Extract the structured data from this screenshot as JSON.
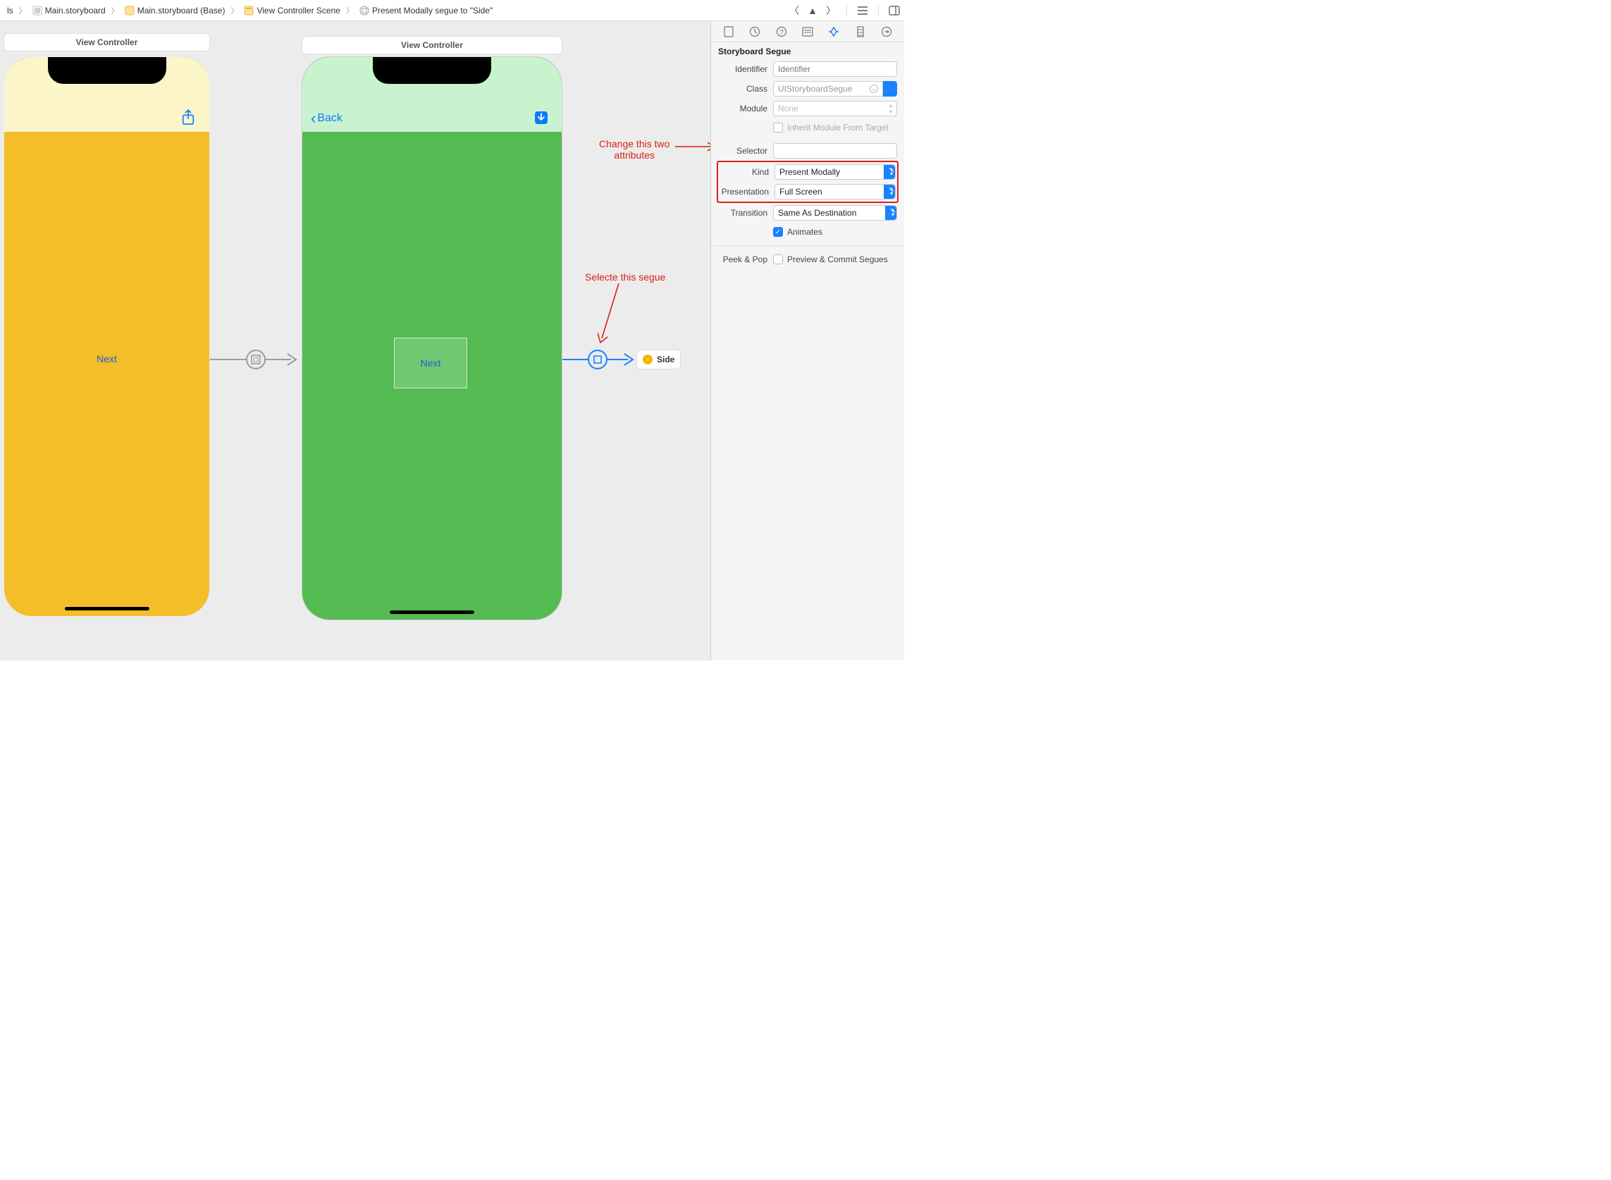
{
  "breadcrumb": {
    "item0": "ls",
    "item1": "Main.storyboard",
    "item2": "Main.storyboard (Base)",
    "item3": "View Controller Scene",
    "item4": "Present Modally segue to \"Side\""
  },
  "canvas": {
    "scene1_title": "View Controller",
    "scene2_title": "View Controller",
    "next_button_1": "Next",
    "next_button_2": "Next",
    "back_button": "Back",
    "side_chip": "Side"
  },
  "annotations": {
    "change_attrs_line1": "Change this two",
    "change_attrs_line2": "attributes",
    "select_segue": "Selecte this segue"
  },
  "inspector": {
    "section_title": "Storyboard Segue",
    "identifier_label": "Identifier",
    "identifier_placeholder": "Identifier",
    "class_label": "Class",
    "class_placeholder": "UIStoryboardSegue",
    "module_label": "Module",
    "module_value": "None",
    "inherit_label": "Inherit Module From Target",
    "selector_label": "Selector",
    "selector_value": "",
    "kind_label": "Kind",
    "kind_value": "Present Modally",
    "presentation_label": "Presentation",
    "presentation_value": "Full Screen",
    "transition_label": "Transition",
    "transition_value": "Same As Destination",
    "animates_label": "Animates",
    "peekpop_label": "Peek & Pop",
    "peekpop_value": "Preview & Commit Segues"
  }
}
